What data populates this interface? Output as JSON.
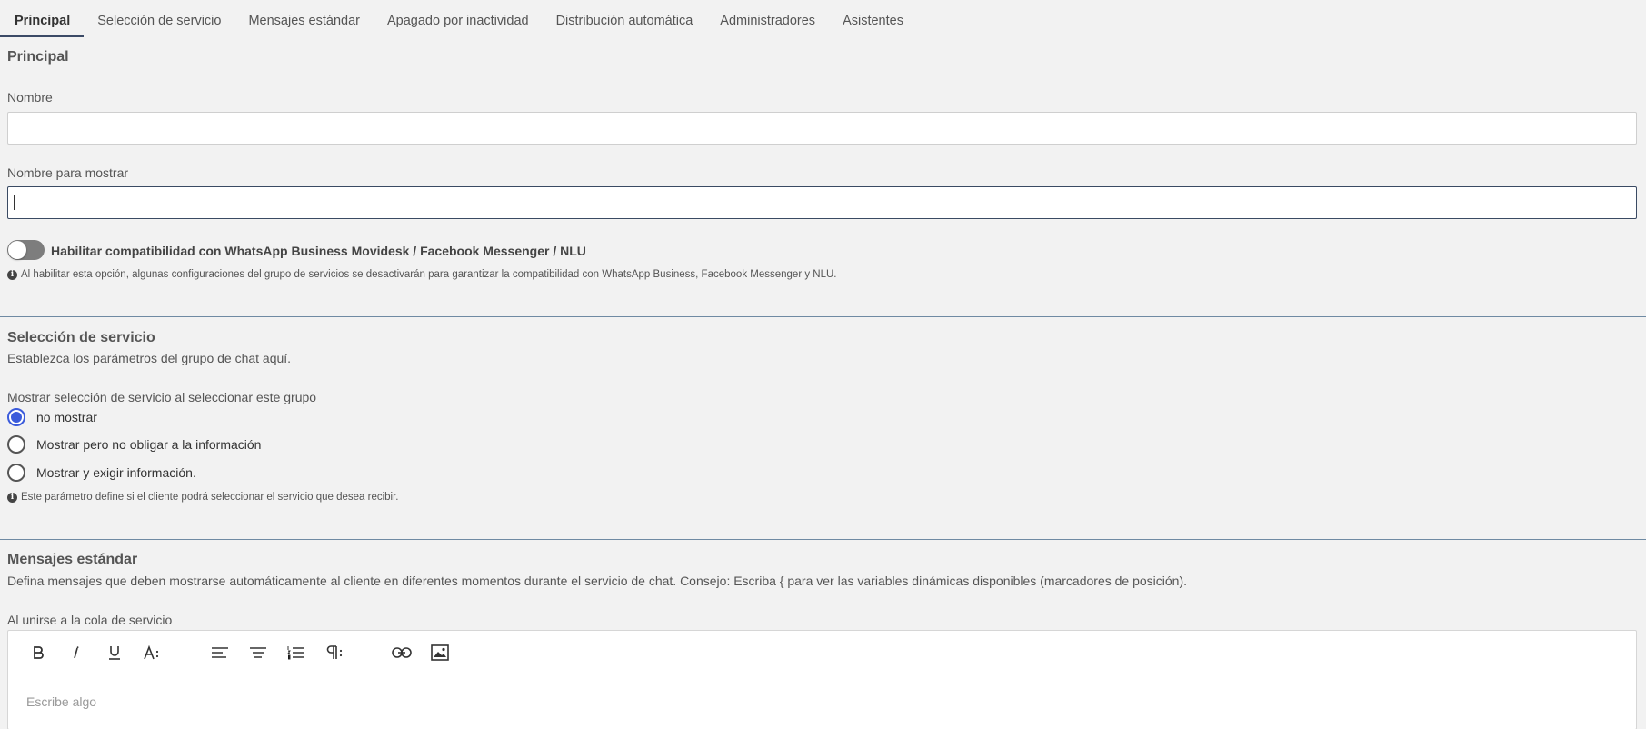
{
  "tabs": [
    {
      "label": "Principal",
      "active": true
    },
    {
      "label": "Selección de servicio"
    },
    {
      "label": "Mensajes estándar"
    },
    {
      "label": "Apagado por inactividad"
    },
    {
      "label": "Distribución automática"
    },
    {
      "label": "Administradores"
    },
    {
      "label": "Asistentes"
    }
  ],
  "principal": {
    "title": "Principal",
    "name_label": "Nombre",
    "name_value": "",
    "display_name_label": "Nombre para mostrar",
    "display_name_value": "",
    "toggle_label": "Habilitar compatibilidad con WhatsApp Business Movidesk / Facebook Messenger / NLU",
    "toggle_on": false,
    "hint": "Al habilitar esta opción, algunas configuraciones del grupo de servicios se desactivarán para garantizar la compatibilidad con WhatsApp Business, Facebook Messenger y NLU."
  },
  "service_selection": {
    "title": "Selección de servicio",
    "description": "Establezca los parámetros del grupo de chat aquí.",
    "question": "Mostrar selección de servicio al seleccionar este grupo",
    "options": [
      {
        "label": "no mostrar",
        "checked": true
      },
      {
        "label": "Mostrar pero no obligar a la información",
        "checked": false
      },
      {
        "label": "Mostrar y exigir información.",
        "checked": false
      }
    ],
    "hint": "Este parámetro define si el cliente podrá seleccionar el servicio que desea recibir."
  },
  "standard_messages": {
    "title": "Mensajes estándar",
    "description": "Defina mensajes que deben mostrarse automáticamente al cliente en diferentes momentos durante el servicio de chat. Consejo: Escriba { para ver las variables dinámicas disponibles (marcadores de posición).",
    "queue_label": "Al unirse a la cola de servicio",
    "editor_placeholder": "Escribe algo"
  },
  "icons": {
    "info": "info-icon",
    "toolbar": [
      "bold-icon",
      "italic-icon",
      "underline-icon",
      "font-size-icon",
      "align-left-icon",
      "align-center-icon",
      "ordered-list-icon",
      "paragraph-icon",
      "link-icon",
      "image-icon"
    ]
  },
  "colors": {
    "accent": "#3b5bdb",
    "tab_underline": "#3b4a66",
    "divider": "#6f8aa3",
    "background": "#f2f2f2"
  }
}
